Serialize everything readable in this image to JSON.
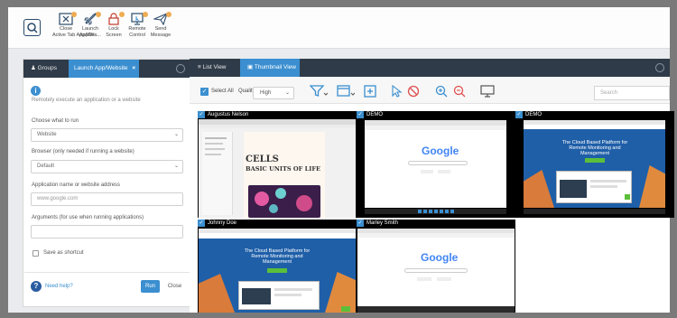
{
  "toolbar": {
    "buttons": [
      {
        "label_line1": "Close",
        "label_line2": "Active Tab App/We...",
        "icon": "close-window-icon"
      },
      {
        "label_line1": "Launch",
        "label_line2": "App/We...",
        "icon": "rocket-icon"
      },
      {
        "label_line1": "Lock",
        "label_line2": "Screen",
        "icon": "lock-icon"
      },
      {
        "label_line1": "Remote",
        "label_line2": "Control",
        "icon": "remote-control-icon"
      },
      {
        "label_line1": "Send",
        "label_line2": "Message",
        "icon": "paper-plane-icon"
      }
    ]
  },
  "left_panel": {
    "tabs": [
      "Groups",
      "Launch App/Website"
    ],
    "description": "Remotely execute an application or a website",
    "choose_label": "Choose what to run",
    "choose_value": "Website",
    "browser_label": "Browser (only needed if running a website)",
    "browser_value": "Default",
    "app_label": "Application name or website address",
    "app_placeholder": "www.google.com",
    "args_label": "Arguments (for use when running applications)",
    "args_value": "",
    "save_shortcut": "Save as shortcut",
    "help_link": "Need help?",
    "run_label": "Run",
    "close_label": "Close"
  },
  "right_panel": {
    "tabs": [
      "List View",
      "Thumbnail View"
    ],
    "select_all": "Select All",
    "quality_label": "Quality",
    "quality_value": "High",
    "search_placeholder": "Search",
    "thumbnails": [
      {
        "name": "Augustus Nelson",
        "screen": "cells-document"
      },
      {
        "name": "DEMO",
        "screen": "google-search"
      },
      {
        "name": "DEMO",
        "screen": "netop-landing"
      },
      {
        "name": "Johnny Doe",
        "screen": "netop-landing"
      },
      {
        "name": "Marley Smith",
        "screen": "google-search"
      }
    ],
    "doc_title_line1": "CELLS",
    "doc_title_line2": "BASIC UNITS OF LIFE",
    "google_logo": "Google",
    "landing_headline": "The Cloud Based Platform for Remote Monitoring and Management"
  },
  "colors": {
    "accent": "#3b8fd0",
    "tab_bar": "#2f3b48",
    "badge": "#f0ac52",
    "landing_bg": "#1f5fa8"
  }
}
